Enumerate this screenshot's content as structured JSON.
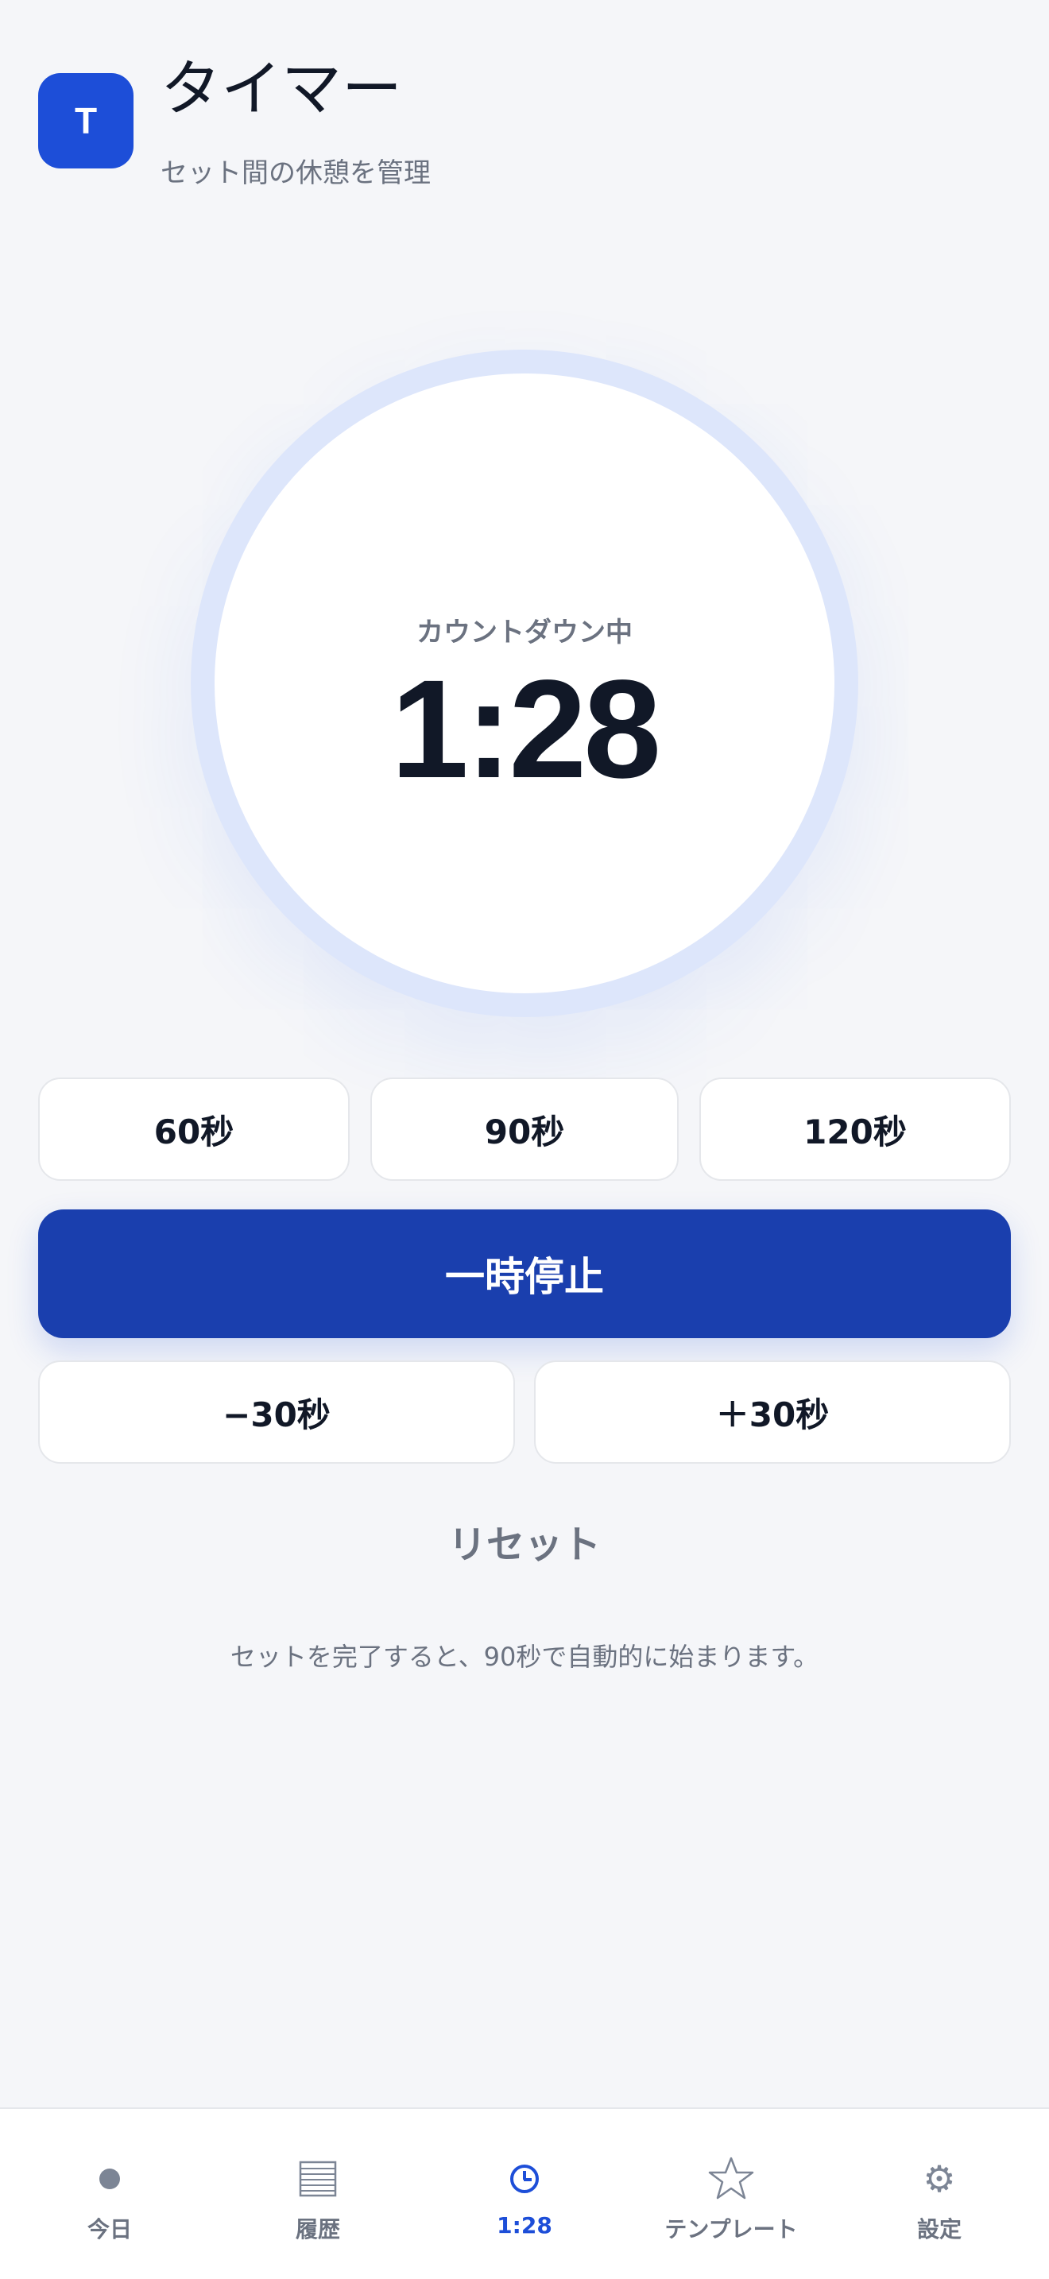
{
  "header": {
    "app_icon_letter": "T",
    "title": "タイマー",
    "subtitle": "セット間の休憩を管理"
  },
  "timer": {
    "status": "カウントダウン中",
    "time": "1:28"
  },
  "presets": [
    {
      "label": "60秒"
    },
    {
      "label": "90秒"
    },
    {
      "label": "120秒"
    }
  ],
  "controls": {
    "pause_label": "一時停止",
    "minus_label": "−30秒",
    "plus_label": "＋30秒",
    "reset_label": "リセット"
  },
  "hint": "セットを完了すると、90秒で自動的に始まります。",
  "bottom_nav": {
    "items": [
      {
        "label": "今日",
        "icon": "dot-icon"
      },
      {
        "label": "履歴",
        "icon": "list-icon"
      },
      {
        "label": "1:28",
        "icon": "clock-icon",
        "active": true
      },
      {
        "label": "テンプレート",
        "icon": "star-icon"
      },
      {
        "label": "設定",
        "icon": "gear-icon"
      }
    ]
  },
  "colors": {
    "accent": "#1d4ed8",
    "pause_button": "#1a3fae",
    "ring": "#dde6fb",
    "background": "#f5f6f9"
  }
}
